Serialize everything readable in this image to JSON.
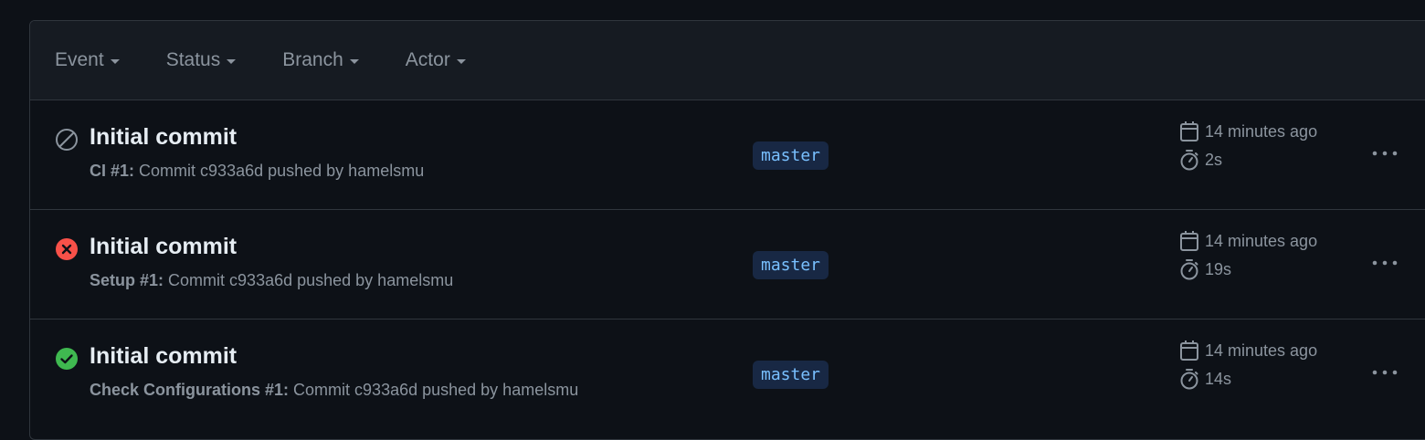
{
  "filters": [
    {
      "label": "Event"
    },
    {
      "label": "Status"
    },
    {
      "label": "Branch"
    },
    {
      "label": "Actor"
    }
  ],
  "runs": [
    {
      "status": "cancelled",
      "status_icon": "cancelled-icon",
      "title": "Initial commit",
      "workflow": "CI #1:",
      "description": "Commit c933a6d pushed by hamelsmu",
      "branch": "master",
      "time": "14 minutes ago",
      "duration": "2s"
    },
    {
      "status": "failure",
      "status_icon": "failure-icon",
      "title": "Initial commit",
      "workflow": "Setup #1:",
      "description": "Commit c933a6d pushed by hamelsmu",
      "branch": "master",
      "time": "14 minutes ago",
      "duration": "19s"
    },
    {
      "status": "success",
      "status_icon": "success-icon",
      "title": "Initial commit",
      "workflow": "Check Configurations #1:",
      "description": "Commit c933a6d pushed by hamelsmu",
      "branch": "master",
      "time": "14 minutes ago",
      "duration": "14s"
    }
  ],
  "colors": {
    "background": "#0d1117",
    "header": "#161b22",
    "border": "#30363d",
    "muted": "#8b949e",
    "failure": "#f85149",
    "success": "#3fb950",
    "branch_bg": "#182844",
    "branch_fg": "#79c0ff"
  }
}
